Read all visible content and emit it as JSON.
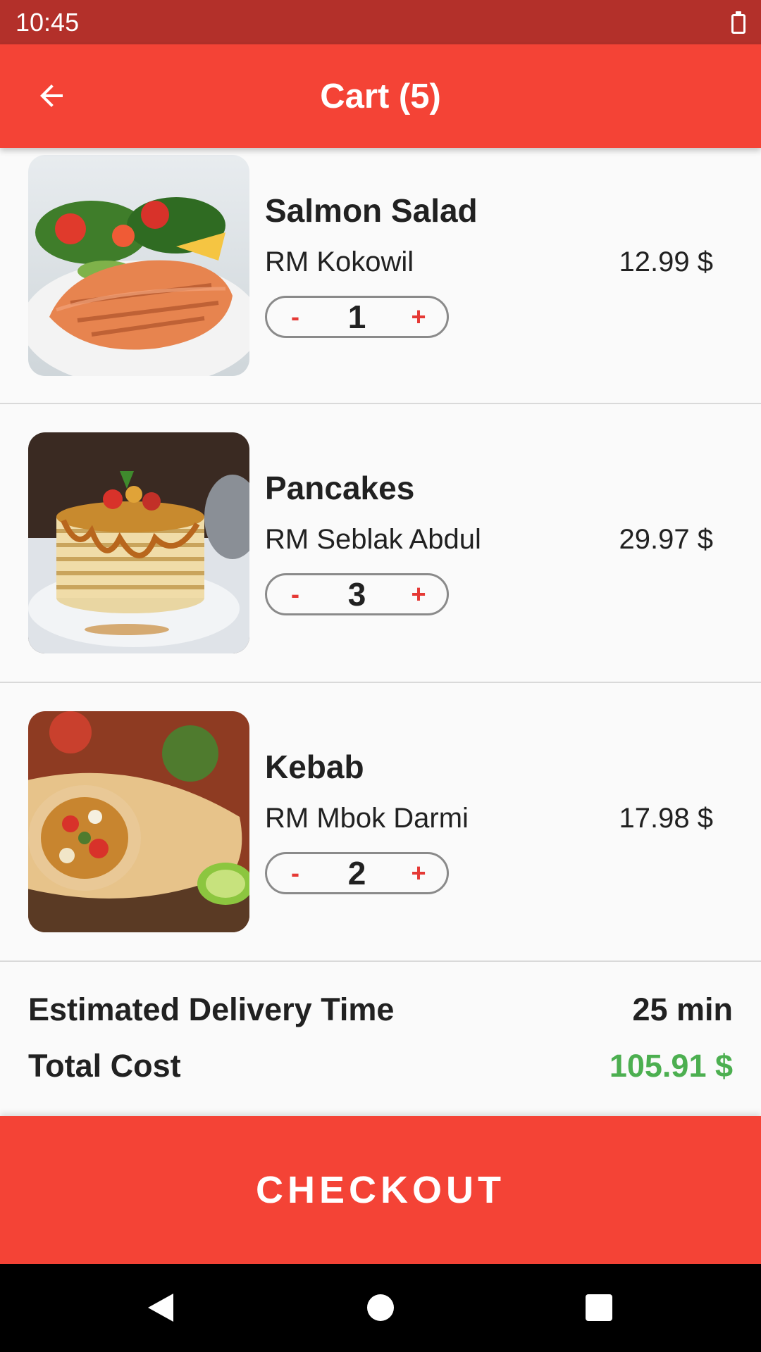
{
  "status_bar": {
    "time": "10:45",
    "battery_icon": "battery-icon"
  },
  "app_bar": {
    "title": "Cart (5)",
    "back_icon": "arrow-back-icon",
    "color": "#f44336"
  },
  "cart_items": [
    {
      "name": "Salmon Salad",
      "restaurant": "RM Kokowil",
      "quantity": "1",
      "price": "12.99 $",
      "minus": "-",
      "plus": "+"
    },
    {
      "name": "Pancakes",
      "restaurant": "RM Seblak Abdul",
      "quantity": "3",
      "price": "29.97 $",
      "minus": "-",
      "plus": "+"
    },
    {
      "name": "Kebab",
      "restaurant": "RM Mbok Darmi",
      "quantity": "2",
      "price": "17.98 $",
      "minus": "-",
      "plus": "+"
    }
  ],
  "summary": {
    "delivery_label": "Estimated Delivery Time",
    "delivery_value": "25 min",
    "total_label": "Total Cost",
    "total_value": "105.91 $",
    "total_color": "#4caf50"
  },
  "checkout_label": "CHECKOUT",
  "nav_bar": {
    "back": "nav-back-icon",
    "home": "nav-home-icon",
    "recents": "nav-recents-icon"
  }
}
